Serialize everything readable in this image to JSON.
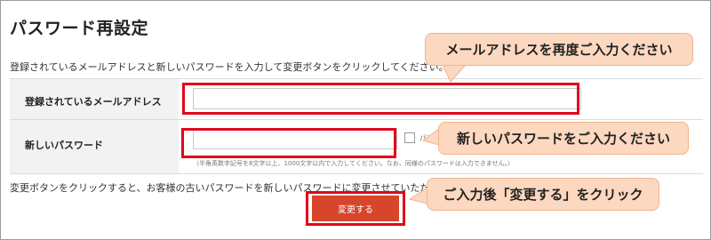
{
  "page": {
    "title": "パスワード再設定",
    "intro": "登録されているメールアドレスと新しいパスワードを入力して変更ボタンをクリックしてください。"
  },
  "form": {
    "email_label": "登録されているメールアドレス",
    "email_value": "",
    "password_label": "新しいパスワード",
    "password_value": "",
    "show_password_label": "パスワ",
    "password_note": "（半角英数字記号を8文字以上、1000文字以内で入力してください。なお、同様のパスワードは入力できません。）"
  },
  "instruction": "変更ボタンをクリックすると、お客様の古いパスワードを新しいパスワードに変更させていただきます。",
  "submit_label": "変更する",
  "callouts": {
    "email": "メールアドレスを再度ご入力ください",
    "password": "新しいパスワードをご入力ください",
    "submit": "ご入力後「変更する」をクリック"
  },
  "colors": {
    "highlight": "#e1051a",
    "callout_fill": "#fbd8bf",
    "button": "#d7452a"
  }
}
